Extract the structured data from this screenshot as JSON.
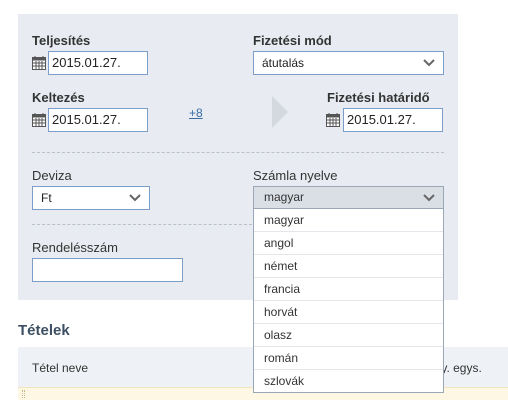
{
  "fields": {
    "teljesites": {
      "label": "Teljesítés",
      "value": "2015.01.27."
    },
    "fizetesi_mod": {
      "label": "Fizetési mód",
      "value": "átutalás"
    },
    "keltezes": {
      "label": "Keltezés",
      "value": "2015.01.27."
    },
    "plus_days": "+8",
    "hatarido": {
      "label": "Fizetési határidő",
      "value": "2015.01.27."
    },
    "deviza": {
      "label": "Deviza",
      "value": "Ft"
    },
    "nyelv": {
      "label": "Számla nyelve",
      "value": "magyar"
    },
    "rendeles": {
      "label": "Rendelésszám",
      "value": ""
    }
  },
  "language_options": [
    "magyar",
    "angol",
    "német",
    "francia",
    "horvát",
    "olasz",
    "román",
    "szlovák"
  ],
  "items_section": {
    "title": "Tételek",
    "col_name": "Tétel neve",
    "col_unit": "nny. egys."
  },
  "colors": {
    "panel": "#e8ecf2",
    "link": "#3a6ea5",
    "input_border": "#7a9ec7"
  },
  "icons": [
    "calendar-icon",
    "chevron-down-icon",
    "arrow-right-icon",
    "drag-handle-icon"
  ]
}
